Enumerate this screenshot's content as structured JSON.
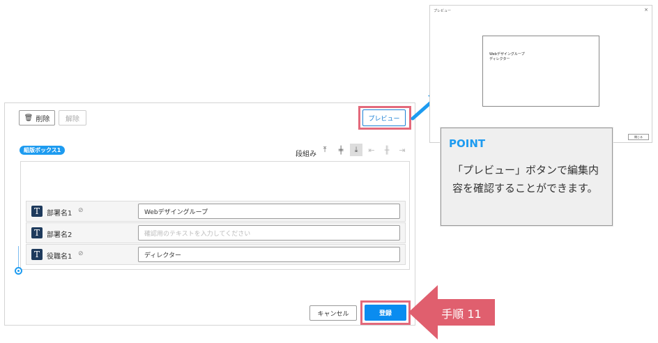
{
  "dialog": {
    "delete_label": "削除",
    "release_label": "解除",
    "preview_label": "プレビュー",
    "group_tag": "組版ボックス1",
    "align_label": "段組み",
    "rows": [
      {
        "label": "部署名1",
        "value": "Webデザイングループ",
        "placeholder": "",
        "linked": true
      },
      {
        "label": "部署名2",
        "value": "",
        "placeholder": "確認用のテキストを入力してください",
        "linked": false
      },
      {
        "label": "役職名1",
        "value": "ディレクター",
        "placeholder": "",
        "linked": true
      }
    ],
    "cancel_label": "キャンセル",
    "register_label": "登録"
  },
  "preview": {
    "title": "プレビュー",
    "close": "×",
    "line1": "Webデザイングループ",
    "line2": "ディレクター",
    "button_label": "閉じる"
  },
  "point": {
    "heading": "POINT",
    "text": "「プレビュー」ボタンで編集内容を確認することができます。"
  },
  "step": {
    "label": "手順 11"
  },
  "colors": {
    "accent": "#1d9bf0",
    "highlight": "#e3697b",
    "step": "#e05f6e",
    "primary": "#0a8cf0"
  }
}
